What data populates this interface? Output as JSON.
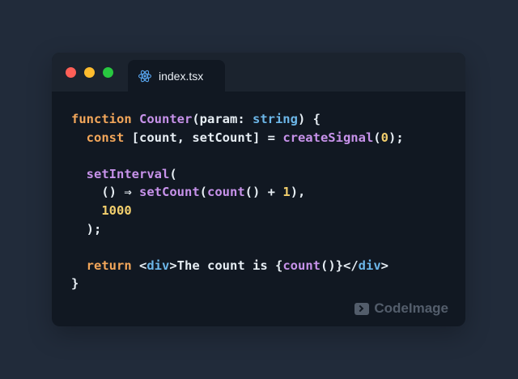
{
  "window": {
    "traffic_lights": [
      "close",
      "minimize",
      "maximize"
    ],
    "tab": {
      "label": "index.tsx",
      "icon": "react-icon"
    }
  },
  "code": {
    "lines": [
      [
        {
          "t": "function",
          "c": "kw"
        },
        {
          "t": " ",
          "c": "pl"
        },
        {
          "t": "Counter",
          "c": "fn"
        },
        {
          "t": "(param: ",
          "c": "pl"
        },
        {
          "t": "string",
          "c": "ty"
        },
        {
          "t": ") {",
          "c": "pl"
        }
      ],
      [
        {
          "t": "  ",
          "c": "pl"
        },
        {
          "t": "const",
          "c": "kw"
        },
        {
          "t": " [count, setCount] = ",
          "c": "pl"
        },
        {
          "t": "createSignal",
          "c": "fn"
        },
        {
          "t": "(",
          "c": "pl"
        },
        {
          "t": "0",
          "c": "nm"
        },
        {
          "t": ");",
          "c": "pl"
        }
      ],
      [],
      [
        {
          "t": "  ",
          "c": "pl"
        },
        {
          "t": "setInterval",
          "c": "fn"
        },
        {
          "t": "(",
          "c": "pl"
        }
      ],
      [
        {
          "t": "    () ⇒ ",
          "c": "pl"
        },
        {
          "t": "setCount",
          "c": "fn"
        },
        {
          "t": "(",
          "c": "pl"
        },
        {
          "t": "count",
          "c": "fn"
        },
        {
          "t": "() + ",
          "c": "pl"
        },
        {
          "t": "1",
          "c": "nm"
        },
        {
          "t": "),",
          "c": "pl"
        }
      ],
      [
        {
          "t": "    ",
          "c": "pl"
        },
        {
          "t": "1000",
          "c": "nm"
        }
      ],
      [
        {
          "t": "  );",
          "c": "pl"
        }
      ],
      [],
      [
        {
          "t": "  ",
          "c": "pl"
        },
        {
          "t": "return",
          "c": "kw"
        },
        {
          "t": " <",
          "c": "pl"
        },
        {
          "t": "div",
          "c": "tg"
        },
        {
          "t": ">The count is {",
          "c": "pl"
        },
        {
          "t": "count",
          "c": "fn"
        },
        {
          "t": "()}</",
          "c": "pl"
        },
        {
          "t": "div",
          "c": "tg"
        },
        {
          "t": ">",
          "c": "pl"
        }
      ],
      [
        {
          "t": "}",
          "c": "pl"
        }
      ]
    ]
  },
  "watermark": {
    "label": "CodeImage",
    "icon": "terminal-icon"
  },
  "colors": {
    "background": "#212b3a",
    "window": "#111822",
    "titlebar": "#1b232e",
    "keyword": "#f2a65a",
    "function": "#c792ea",
    "type": "#6cb6e8",
    "number": "#f3cf6d",
    "plain": "#e6edf3"
  }
}
